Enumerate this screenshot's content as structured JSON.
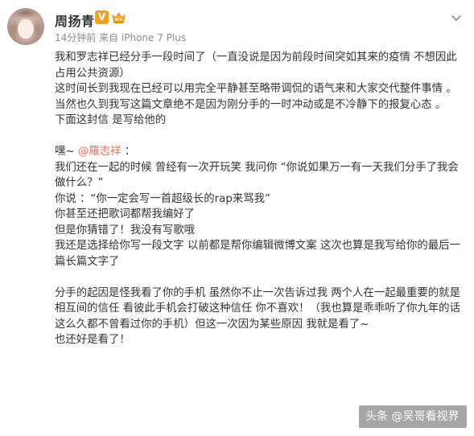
{
  "header": {
    "username": "周扬青",
    "verified_badge": "V",
    "level_icon": "member-crown-icon",
    "meta": "14分钟前 来自 iPhone 7 Plus",
    "more_icon": "chevron-down-icon"
  },
  "post": {
    "p1": "我和罗志祥已经分手一段时间了（一直没说是因为前段时间突如其来的疫情 不想因此占用公共资源）",
    "p2": "这时间长到我现在已经可以用完全平静甚至略带调侃的语气来和大家交代整件事情 。当然也久到我写这篇文章绝不是因为刚分手的一时冲动或是不冷静下的报复心态 。",
    "p3": "下面这封信 是写给他的",
    "greeting_prefix": "嘿~ ",
    "mention": "@羅志祥",
    "greeting_suffix": " ：",
    "p4": "我们还在一起的时候 曾经有一次开玩笑 我问你 “你说如果万一有一天我们分手了我会做什么？”",
    "p5": "你说 ：“你一定会写一首超级长的rap来骂我”",
    "p6": "你甚至还把歌词都帮我编好了",
    "p7": "但是你猜错了！我没有写歌哦",
    "p8": "我还是选择给你写一段文字  以前都是帮你编辑微博文案 这次也算是我写给你的最后一篇长篇文字了",
    "p9": "分手的起因是怪我看了你的手机  虽然你不止一次告诉过我  两个人在一起最重要的就是相互间的信任  看彼此手机会打破这种信任 你不喜欢！（我也算是乖乖听了你九年的话 这么久都不曾看过你的手机）但这一次因为某些原因  我就是看了~",
    "p10": "也还好是看了！"
  },
  "watermark": {
    "text": "头条 @吴哥看视界"
  },
  "colors": {
    "text": "#333333",
    "meta": "#8c8c8c",
    "mention": "#eb7350",
    "badge": "#f2a31b"
  }
}
